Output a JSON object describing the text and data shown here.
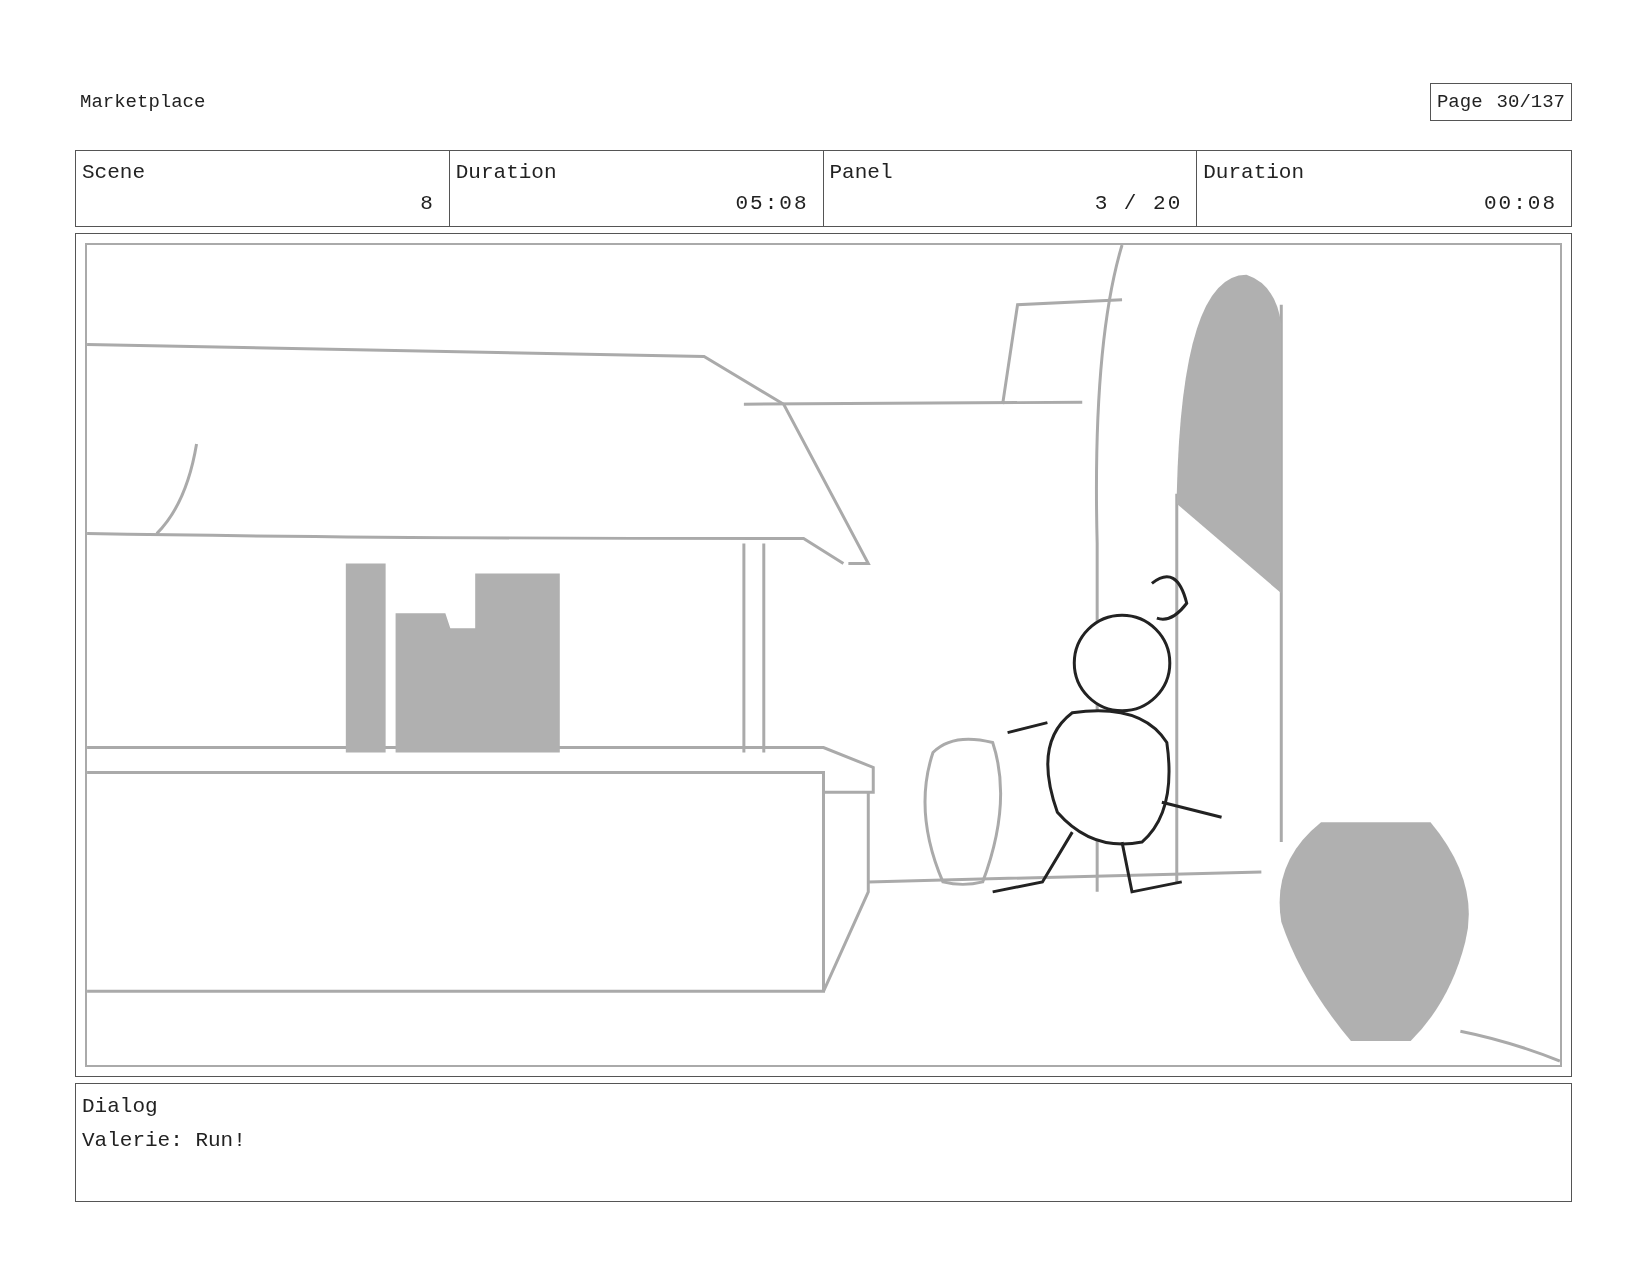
{
  "title": "Marketplace",
  "page": {
    "label": "Page",
    "value": "30/137"
  },
  "header": [
    {
      "label": "Scene",
      "value": "8"
    },
    {
      "label": "Duration",
      "value": "05:08"
    },
    {
      "label": "Panel",
      "value": "3 / 20"
    },
    {
      "label": "Duration",
      "value": "00:08"
    }
  ],
  "dialog": {
    "label": "Dialog",
    "text": "Valerie: Run!"
  }
}
